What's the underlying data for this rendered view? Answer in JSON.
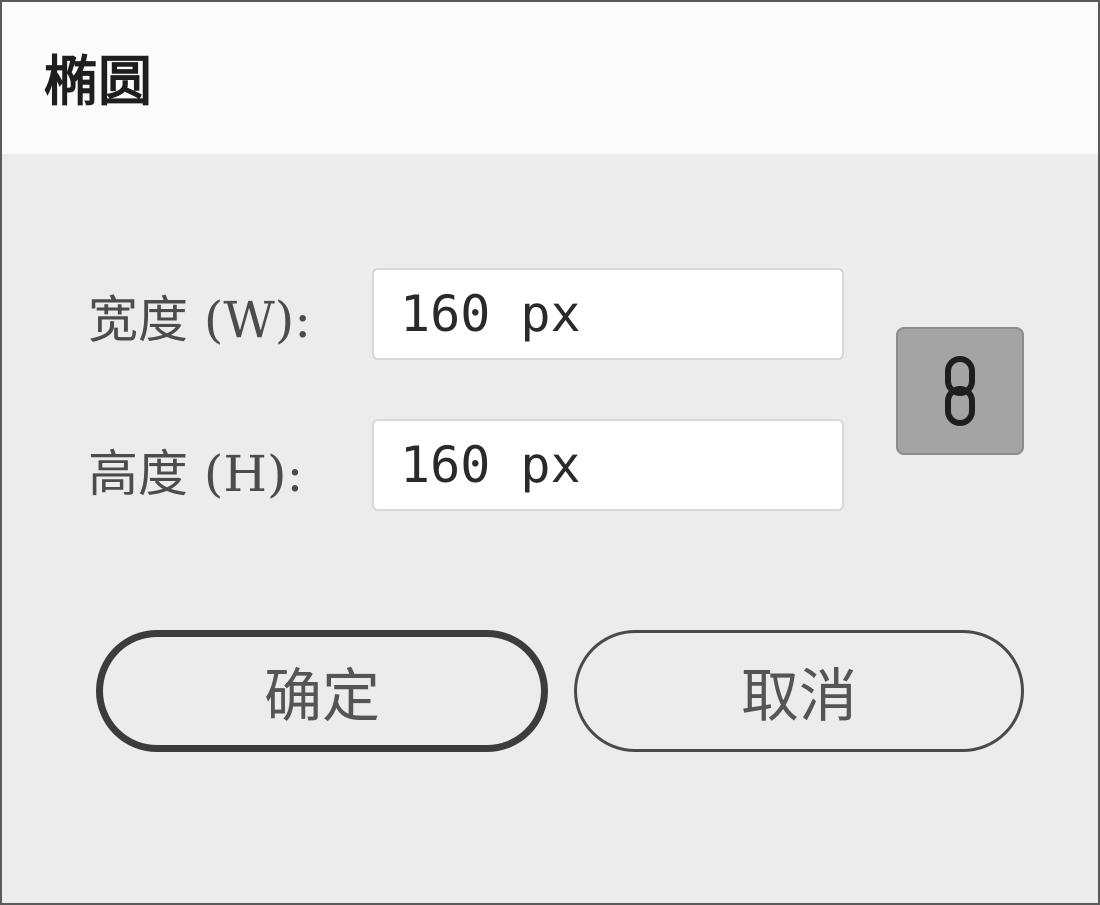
{
  "dialog": {
    "title": "椭圆"
  },
  "fields": {
    "width": {
      "label": "宽度 (W):",
      "value": "160 px"
    },
    "height": {
      "label": "高度 (H):",
      "value": "160 px"
    }
  },
  "constrain_proportions": {
    "icon": "link-icon",
    "active": true
  },
  "buttons": {
    "ok_label": "确定",
    "cancel_label": "取消"
  }
}
